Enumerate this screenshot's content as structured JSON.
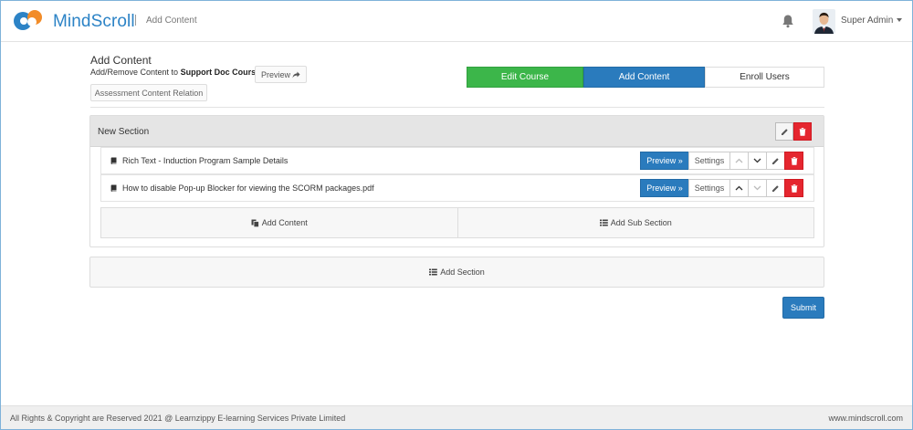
{
  "header": {
    "brand": "MindScroll",
    "breadcrumb": "Add Content",
    "user_name": "Super Admin"
  },
  "page": {
    "title": "Add Content",
    "subtitle_prefix": "Add/Remove Content to",
    "course_name": "Support Doc Course",
    "preview_label": "Preview",
    "relation_label": "Assessment Content Relation"
  },
  "tabs": [
    {
      "label": "Edit Course",
      "active": false
    },
    {
      "label": "Add Content",
      "active": true
    },
    {
      "label": "Enroll Users",
      "active": false
    }
  ],
  "section": {
    "title": "New Section",
    "items": [
      {
        "label": "Rich Text - Induction Program Sample Details",
        "preview": "Preview »",
        "settings": "Settings"
      },
      {
        "label": "How to disable Pop-up Blocker for viewing the SCORM packages.pdf",
        "preview": "Preview »",
        "settings": "Settings"
      }
    ],
    "add_content_label": "Add Content",
    "add_subsection_label": "Add Sub Section"
  },
  "add_section_label": "Add Section",
  "submit_label": "Submit",
  "footer": {
    "copyright": "All Rights & Copyright are Reserved 2021 @ Learnzippy E-learning Services Private Limited",
    "website": "www.mindscroll.com"
  },
  "colors": {
    "brand_blue": "#2a7bbd",
    "success_green": "#3cb64a",
    "danger_red": "#e5262f",
    "logo_orange": "#f28c28"
  },
  "icons": [
    "bell-icon",
    "avatar",
    "share-icon",
    "book-icon",
    "chevron-up-icon",
    "chevron-down-icon",
    "pencil-icon",
    "trash-icon",
    "copy-icon",
    "list-icon"
  ]
}
